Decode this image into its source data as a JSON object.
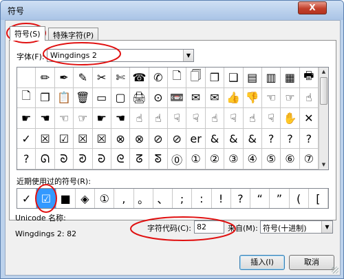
{
  "window": {
    "title": "符号",
    "close_label": "X"
  },
  "tabs": [
    {
      "label": "符号(S)"
    },
    {
      "label": "特殊字符(P)"
    }
  ],
  "font": {
    "label": "字体(F):",
    "value": "Wingdings 2"
  },
  "grid": [
    [
      "",
      "✏",
      "✒",
      "✎",
      "✂",
      "✄",
      "☎",
      "✆",
      "🗋",
      "🗍",
      "❐",
      "❑",
      "▤",
      "▥",
      "▦",
      "🖶"
    ],
    [
      "🗋",
      "❐",
      "📋",
      "🗑",
      "▭",
      "▢",
      "🖨",
      "⊙",
      "📼",
      "✉",
      "✉",
      "👍",
      "👎",
      "☜",
      "☞",
      "☝"
    ],
    [
      "☛",
      "☚",
      "☜",
      "☞",
      "☛",
      "☚",
      "☝",
      "☝",
      "☟",
      "☟",
      "☝",
      "☟",
      "☝",
      "☟",
      "✋",
      "✕"
    ],
    [
      "✓",
      "☒",
      "☑",
      "☒",
      "☒",
      "⊗",
      "⊗",
      "⊘",
      "⊘",
      "er",
      "&",
      "&",
      "&",
      "?",
      "?",
      "?"
    ],
    [
      "?",
      "ᘏ",
      "ᘐ",
      "ᘑ",
      "ᘒ",
      "ᘓ",
      "ᘔ",
      "ᘕ",
      "⓪",
      "①",
      "②",
      "③",
      "④",
      "⑤",
      "⑥",
      "⑦"
    ]
  ],
  "recent": {
    "label": "近期使用过的符号(R):",
    "symbols": [
      "✓",
      "☑",
      "■",
      "◈",
      "①",
      ",",
      "。",
      "、",
      ";",
      ":",
      "!",
      "?",
      "“",
      "”",
      "(",
      "["
    ]
  },
  "unicode_label": "Unicode 名称:",
  "unicode_name": "Wingdings 2: 82",
  "code": {
    "label": "字符代码(C):",
    "value": "82"
  },
  "from": {
    "label": "来自(M):",
    "value": "符号(十进制)"
  },
  "buttons": {
    "insert": "插入(I)",
    "cancel": "取消"
  },
  "icons": {
    "dropdown": "chevron-down-icon",
    "scroll_up": "arrow-up-icon",
    "scroll_down": "arrow-down-icon"
  }
}
